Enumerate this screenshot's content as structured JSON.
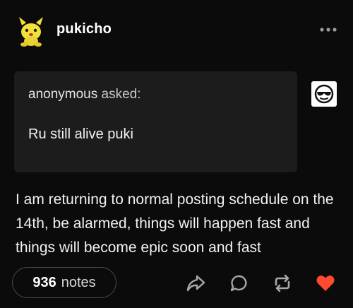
{
  "header": {
    "username": "pukicho",
    "avatar_icon": "yellow-creature-avatar",
    "more_icon": "ellipsis-icon"
  },
  "ask": {
    "asker_name": "anonymous",
    "asker_suffix": " asked:",
    "question": "Ru still alive puki",
    "anon_avatar_icon": "sunglasses-face-icon"
  },
  "post": {
    "body": "I am returning to normal posting schedule on the 14th, be alarmed, things will happen fast and things will become epic soon and fast"
  },
  "footer": {
    "notes_count": "936",
    "notes_label": "notes",
    "actions": [
      "share-icon",
      "reply-icon",
      "reblog-icon",
      "like-icon"
    ],
    "like_color": "#ff4930"
  }
}
